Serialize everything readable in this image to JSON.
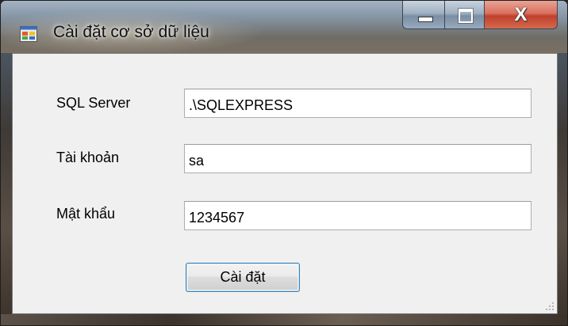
{
  "window": {
    "title": "Cài đặt cơ sở dữ liệu",
    "icon": "app-window-icon",
    "close_glyph": "X"
  },
  "form": {
    "server": {
      "label": "SQL Server",
      "value": ".\\SQLEXPRESS"
    },
    "account": {
      "label": "Tài khoản",
      "value": "sa"
    },
    "password": {
      "label": "Mật khẩu",
      "value": "1234567"
    },
    "submit_label": "Cài đặt"
  }
}
